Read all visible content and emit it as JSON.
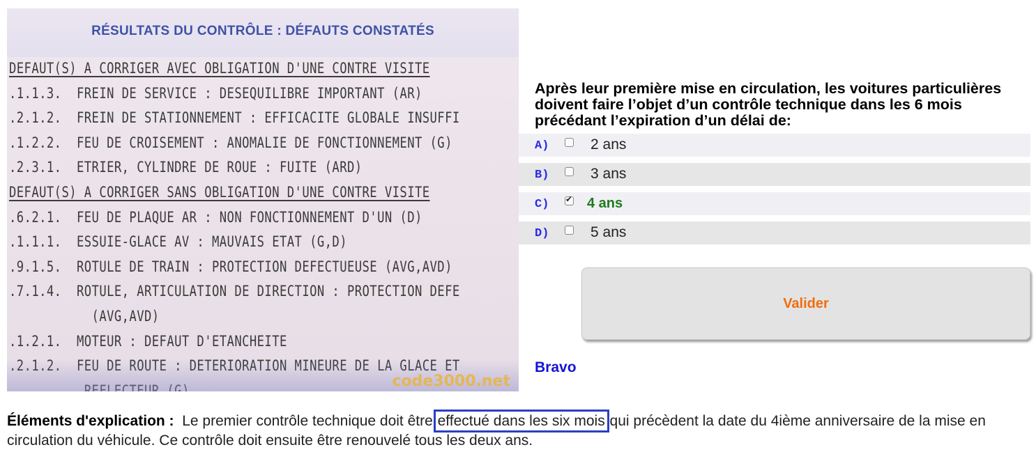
{
  "photo": {
    "title": "RÉSULTATS DU CONTRÔLE : DÉFAUTS CONSTATÉS",
    "lines": [
      {
        "text": "DEFAUT(S) A CORRIGER AVEC OBLIGATION D'UNE CONTRE VISITE",
        "type": "header"
      },
      {
        "text": ".1.1.3.  FREIN DE SERVICE : DESEQUILIBRE IMPORTANT (AR)",
        "type": "item"
      },
      {
        "text": ".2.1.2.  FREIN DE STATIONNEMENT : EFFICACITE GLOBALE INSUFFI",
        "type": "item"
      },
      {
        "text": ".1.2.2.  FEU DE CROISEMENT : ANOMALIE DE FONCTIONNEMENT (G)",
        "type": "item"
      },
      {
        "text": ".2.3.1.  ETRIER, CYLINDRE DE ROUE : FUITE (ARD)",
        "type": "item"
      },
      {
        "text": "DEFAUT(S) A CORRIGER SANS OBLIGATION D'UNE CONTRE VISITE",
        "type": "header"
      },
      {
        "text": ".6.2.1.  FEU DE PLAQUE AR : NON FONCTIONNEMENT D'UN (D)",
        "type": "item"
      },
      {
        "text": ".1.1.1.  ESSUIE-GLACE AV : MAUVAIS ETAT (G,D)",
        "type": "item"
      },
      {
        "text": ".9.1.5.  ROTULE DE TRAIN : PROTECTION DEFECTUEUSE (AVG,AVD)",
        "type": "item"
      },
      {
        "text": ".7.1.4.  ROTULE, ARTICULATION DE DIRECTION : PROTECTION DEFE",
        "type": "item"
      },
      {
        "text": "           (AVG,AVD)",
        "type": "item"
      },
      {
        "text": ".1.2.1.  MOTEUR : DEFAUT D'ETANCHEITE",
        "type": "item"
      },
      {
        "text": ".2.1.2.  FEU DE ROUTE : DETERIORATION MINEURE DE LA GLACE ET",
        "type": "item"
      },
      {
        "text": "          REFLECTEUR (G)",
        "type": "item"
      }
    ],
    "watermark": "code3000.net"
  },
  "question": {
    "text": "Après leur première mise en circulation, les voitures particulières doivent faire l’objet d’un contrôle technique dans les 6 mois précédant l’expiration d’un délai de:"
  },
  "answers": [
    {
      "letter": "A)",
      "label": "2 ans",
      "checked": false,
      "correct": false
    },
    {
      "letter": "B)",
      "label": "3 ans",
      "checked": false,
      "correct": false
    },
    {
      "letter": "C)",
      "label": "4 ans",
      "checked": true,
      "correct": true
    },
    {
      "letter": "D)",
      "label": "5 ans",
      "checked": false,
      "correct": false
    }
  ],
  "valider_label": "Valider",
  "feedback": "Bravo",
  "explanation": {
    "label": "Éléments d'explication :",
    "before": "Le premier contrôle technique doit être",
    "highlight": "effectué dans les six mois",
    "after": "qui précèdent la date du 4ième anniversaire de la mise en circulation du véhicule. Ce contrôle doit ensuite être renouvelé tous les deux ans."
  },
  "colors": {
    "answer_letter": "#2a2ae8",
    "correct_answer": "#1f7a1f",
    "valider_text": "#f06d10",
    "feedback": "#1414d8",
    "highlight_box": "#2b3fc2"
  }
}
